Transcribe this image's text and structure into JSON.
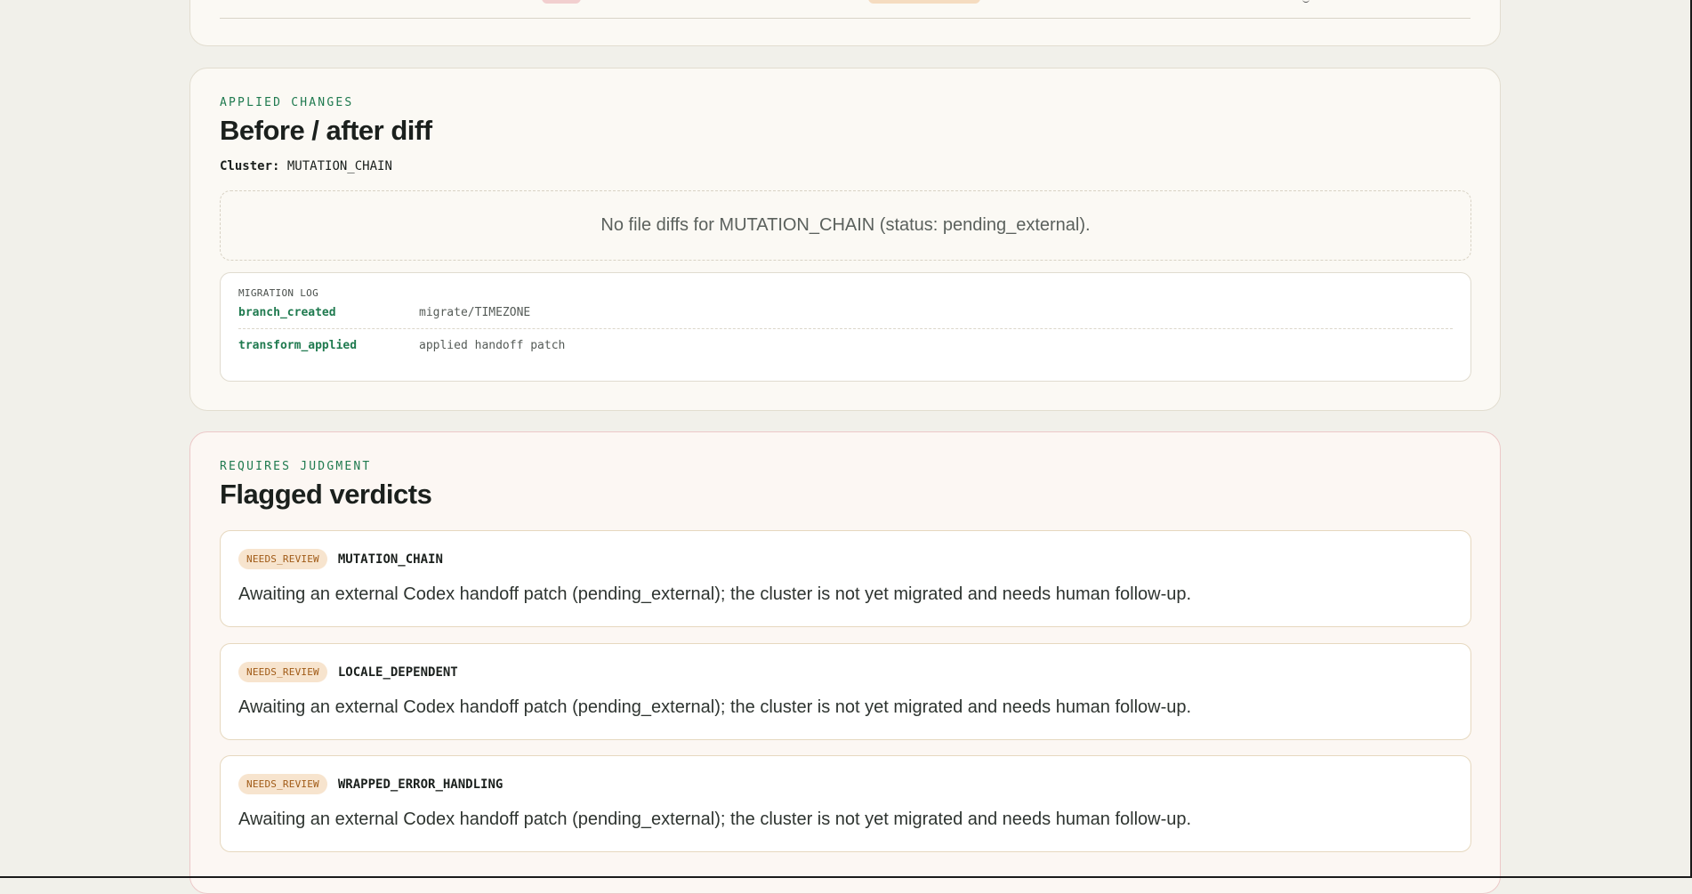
{
  "applied_changes": {
    "eyebrow": "APPLIED CHANGES",
    "title": "Before / after diff",
    "cluster_label": "Cluster:",
    "cluster_value": "MUTATION_CHAIN",
    "empty_message": "No file diffs for MUTATION_CHAIN (status: pending_external).",
    "migration_log": {
      "heading": "MIGRATION LOG",
      "rows": [
        {
          "key": "branch_created",
          "value": "migrate/TIMEZONE"
        },
        {
          "key": "transform_applied",
          "value": "applied handoff patch"
        }
      ]
    }
  },
  "judgment": {
    "eyebrow": "REQUIRES JUDGMENT",
    "title": "Flagged verdicts",
    "verdicts": [
      {
        "badge": "NEEDS_REVIEW",
        "cluster": "MUTATION_CHAIN",
        "text": "Awaiting an external Codex handoff patch (pending_external); the cluster is not yet migrated and needs human follow-up."
      },
      {
        "badge": "NEEDS_REVIEW",
        "cluster": "LOCALE_DEPENDENT",
        "text": "Awaiting an external Codex handoff patch (pending_external); the cluster is not yet migrated and needs human follow-up."
      },
      {
        "badge": "NEEDS_REVIEW",
        "cluster": "WRAPPED_ERROR_HANDLING",
        "text": "Awaiting an external Codex handoff patch (pending_external); the cluster is not yet migrated and needs human follow-up."
      }
    ]
  },
  "colors": {
    "background": "#f1f0ea",
    "accent_green": "#1f7a4f",
    "badge_bg": "#f7e4ce",
    "badge_text": "#a05a16",
    "judgment_border": "#ecc8c8"
  }
}
